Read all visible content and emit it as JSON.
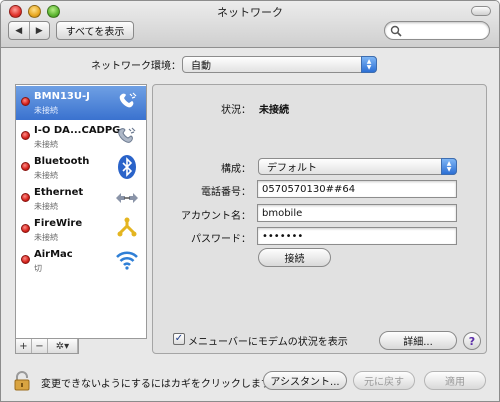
{
  "window": {
    "title": "ネットワーク"
  },
  "toolbar": {
    "back": "◀",
    "forward": "▶",
    "show_all": "すべてを表示",
    "search_placeholder": ""
  },
  "location": {
    "label": "ネットワーク環境：",
    "value": "自動"
  },
  "services": [
    {
      "name": "BMN13U-J",
      "status": "未接続",
      "icon": "phone-modem-icon",
      "selected": true
    },
    {
      "name": "I-O DA...CADPG",
      "status": "未接続",
      "icon": "phone-modem-icon",
      "selected": false
    },
    {
      "name": "Bluetooth",
      "status": "未接続",
      "icon": "bluetooth-icon",
      "selected": false
    },
    {
      "name": "Ethernet",
      "status": "未接続",
      "icon": "ethernet-icon",
      "selected": false
    },
    {
      "name": "FireWire",
      "status": "未接続",
      "icon": "firewire-icon",
      "selected": false
    },
    {
      "name": "AirMac",
      "status": "切",
      "icon": "airmac-icon",
      "selected": false
    }
  ],
  "sidebar_controls": {
    "add": "+",
    "remove": "−",
    "action": "✲▾"
  },
  "detail": {
    "status_label": "状況：",
    "status_value": "未接続",
    "config_label": "構成：",
    "config_value": "デフォルト",
    "phone_label": "電話番号：",
    "phone_value": "0570570130##64",
    "account_label": "アカウント名：",
    "account_value": "bmobile",
    "password_label": "パスワード：",
    "password_value": "•••••••",
    "connect_button": "接続",
    "menubar_checkbox_label": "メニューバーにモデムの状況を表示",
    "menubar_checked": true,
    "advanced_button": "詳細...",
    "help": "?"
  },
  "footer": {
    "lock_text": "変更できないようにするにはカギをクリックします。",
    "assistant_button": "アシスタント...",
    "revert_button": "元に戻す",
    "apply_button": "適用"
  },
  "colors": {
    "selection": "#3a72cf",
    "status_red": "#d4221b",
    "accent_blue": "#2c6fd4"
  }
}
